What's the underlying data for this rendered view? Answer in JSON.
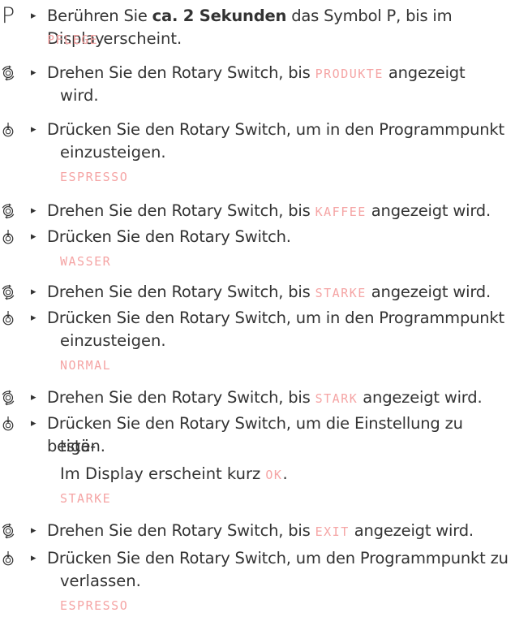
{
  "steps": {
    "s1": {
      "icon": "P",
      "pre": "Berühren Sie ",
      "bold": "ca. 2 Sekunden",
      "mid": " das Symbol P, bis im Display",
      "disp": "PFLEGE",
      "post": " erscheint."
    },
    "s2": {
      "pre": "Drehen Sie den Rotary Switch, bis ",
      "disp": "PRODUKTE",
      "post": " angezeigt",
      "cont": "wird."
    },
    "s3": {
      "line1": "Drücken Sie den Rotary Switch, um in den Programmpunkt",
      "line2": "einzusteigen.",
      "disp": "ESPRESSO"
    },
    "s4": {
      "pre": "Drehen Sie den Rotary Switch, bis ",
      "disp": "KAFFEE",
      "post": " angezeigt wird."
    },
    "s5": {
      "line1": "Drücken Sie den Rotary Switch.",
      "disp": "WASSER"
    },
    "s6": {
      "pre": "Drehen Sie den Rotary Switch, bis ",
      "disp": "STARKE",
      "post": " angezeigt wird."
    },
    "s7": {
      "line1": "Drücken Sie den Rotary Switch, um in den Programmpunkt",
      "line2": "einzusteigen.",
      "disp": "NORMAL"
    },
    "s8": {
      "pre": "Drehen Sie den Rotary Switch, bis ",
      "disp": "STARK",
      "post": " angezeigt wird."
    },
    "s9": {
      "line1": "Drücken Sie den Rotary Switch, um die Einstellung zu bestä-",
      "line2": "tigen.",
      "line3pre": "Im Display erscheint kurz ",
      "line3disp": "OK",
      "line3post": ".",
      "disp": "STARKE"
    },
    "s10": {
      "pre": "Drehen Sie den Rotary Switch, bis ",
      "disp": "EXIT",
      "post": " angezeigt wird."
    },
    "s11": {
      "line1": "Drücken Sie den Rotary Switch, um den Programmpunkt zu",
      "line2": "verlassen.",
      "disp": "ESPRESSO"
    }
  },
  "bullet": "▸",
  "icons": {
    "rotate": "rotate-icon",
    "press": "press-icon"
  },
  "colors": {
    "text": "#333333",
    "display": "#f5a5a5"
  }
}
